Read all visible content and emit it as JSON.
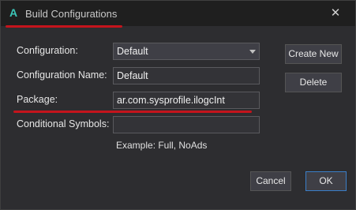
{
  "window": {
    "title": "Build Configurations",
    "app_icon": "A",
    "close_glyph": "✕"
  },
  "form": {
    "configuration_label": "Configuration:",
    "configuration_value": "Default",
    "configuration_name_label": "Configuration Name:",
    "configuration_name_value": "Default",
    "package_label": "Package:",
    "package_value": "ar.com.sysprofile.ilogcInt",
    "symbols_label": "Conditional Symbols:",
    "symbols_value": "",
    "symbols_hint": "Example: Full, NoAds"
  },
  "buttons": {
    "create_new": "Create New",
    "delete": "Delete",
    "cancel": "Cancel",
    "ok": "OK"
  },
  "colors": {
    "accent_teal": "#3cc6b8",
    "annotation_red": "#c4141c",
    "ok_border": "#3a7ec8"
  }
}
